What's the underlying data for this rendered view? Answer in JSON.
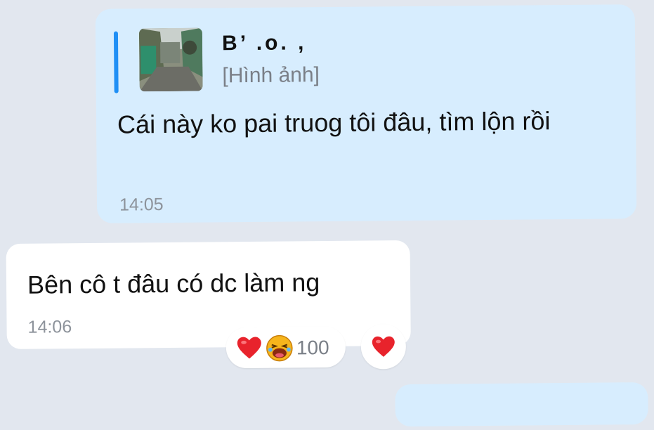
{
  "outgoing_message": {
    "quote": {
      "sender": "B’ .o. ,",
      "type_label": "[Hình ảnh]"
    },
    "text": "Cái này ko pai truog tôi đâu, tìm lộn rồi",
    "time": "14:05"
  },
  "incoming_message": {
    "text": "Bên cô t đâu có dc làm ng",
    "time": "14:06",
    "reactions": {
      "icons": [
        "heart-icon",
        "laughing-face-icon"
      ],
      "count": "100"
    },
    "react_button_icon": "heart-icon"
  },
  "colors": {
    "background": "#e2e7ef",
    "outgoing_bubble": "#d7edfe",
    "incoming_bubble": "#ffffff",
    "quote_bar": "#1f8ff5",
    "heart": "#e8232c"
  }
}
